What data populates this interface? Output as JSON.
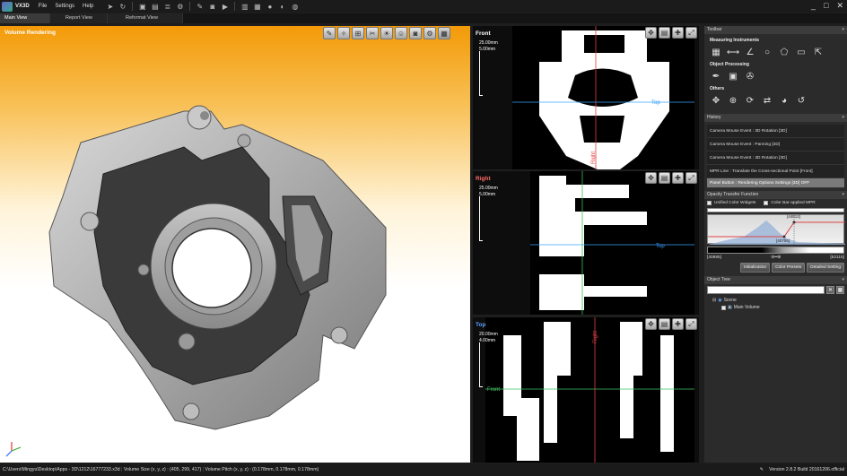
{
  "app": {
    "title": "VX3D",
    "menu": [
      "File",
      "Settings",
      "Help"
    ],
    "toolbar_icons": [
      "pointer-icon",
      "rotate-icon",
      "save-icon",
      "folder-icon",
      "layers-icon",
      "gear-icon",
      "measure-icon",
      "camera-icon",
      "video-icon",
      "chart-icon",
      "grid-icon",
      "sphere-icon",
      "palette-icon",
      "globe-icon"
    ],
    "window_controls": [
      "_",
      "□",
      "✕"
    ]
  },
  "tabs": [
    {
      "label": "Main View",
      "active": true
    },
    {
      "label": "Report View",
      "active": false
    },
    {
      "label": "Reformat View",
      "active": false
    }
  ],
  "volume_view": {
    "title": "Volume Rendering",
    "tools": [
      "pen-icon",
      "spray-icon",
      "ruler-icon",
      "scissors-icon",
      "light-icon",
      "person-icon",
      "camera-icon",
      "gear-icon",
      "grid-icon"
    ]
  },
  "mpr_views": [
    {
      "title": "Front",
      "title_color": "#ffffff",
      "scale1": "25.00mm",
      "scale2": "5.00mm",
      "line_label": "Top",
      "axis_label": "Right"
    },
    {
      "title": "Right",
      "title_color": "#ff6a6a",
      "scale1": "25.00mm",
      "scale2": "5.00mm",
      "line_label": "Top",
      "axis_label": "Front"
    },
    {
      "title": "Top",
      "title_color": "#5aa0ff",
      "scale1": "20.00mm",
      "scale2": "4.00mm",
      "line_label": "Front",
      "axis_label": "Right"
    }
  ],
  "panel": {
    "toolbar_header": "Toolbar",
    "measuring_title": "Measuring Instruments",
    "measuring_icons": [
      "grid-measure-icon",
      "line-icon",
      "angle-icon",
      "circle-icon",
      "polygon-icon",
      "note-icon",
      "export-icon"
    ],
    "object_title": "Object Processing",
    "object_icons": [
      "eyedropper-icon",
      "volume-crop-icon",
      "sculpt-icon"
    ],
    "others_title": "Others",
    "others_icons": [
      "move-icon",
      "zoom-icon",
      "rotate-icon",
      "flip-icon",
      "color-icon",
      "reset-icon"
    ],
    "history_header": "History",
    "history": [
      "Camera Mouse Event : 3D Rotation [3D]",
      "Camera Mouse Event : Panning [3D]",
      "Camera Mouse Event : 3D Rotation [3D]",
      "MPR Line : Translate the Cross-sectional Point [Front]",
      "Panel Button : Rendering Options Settings [3D] OFF"
    ],
    "otf_header": "Opacity Transfer Function",
    "unified_label": "Unified Color Widgets",
    "colorbar_label": "Color Bar-applied MPR",
    "otf_top_value": "[44812]",
    "otf_mid_value": "[40705]",
    "otf_min": "[40885]",
    "otf_max": "[52115]",
    "buttons": [
      "Initialization",
      "Color Presets",
      "Detailed Setting"
    ],
    "tree_header": "Object Tree",
    "tree_clear": "✕",
    "tree_nodes": [
      {
        "label": "Scene",
        "icon": "scene-icon"
      },
      {
        "label": "Main Volume",
        "icon": "volume-icon"
      }
    ]
  },
  "status": {
    "path": "C:\\Users\\Mingyu\\Desktop\\Apps - 3D\\1212\\16777233.x3d",
    "size": "Volume Size (x, y, z) : (405, 299, 417)",
    "pitch": "Volume Pitch (x, y, z) : (0.178mm, 0.178mm, 0.178mm)",
    "version": "Version 2.8.2 Build 20161206.official"
  }
}
